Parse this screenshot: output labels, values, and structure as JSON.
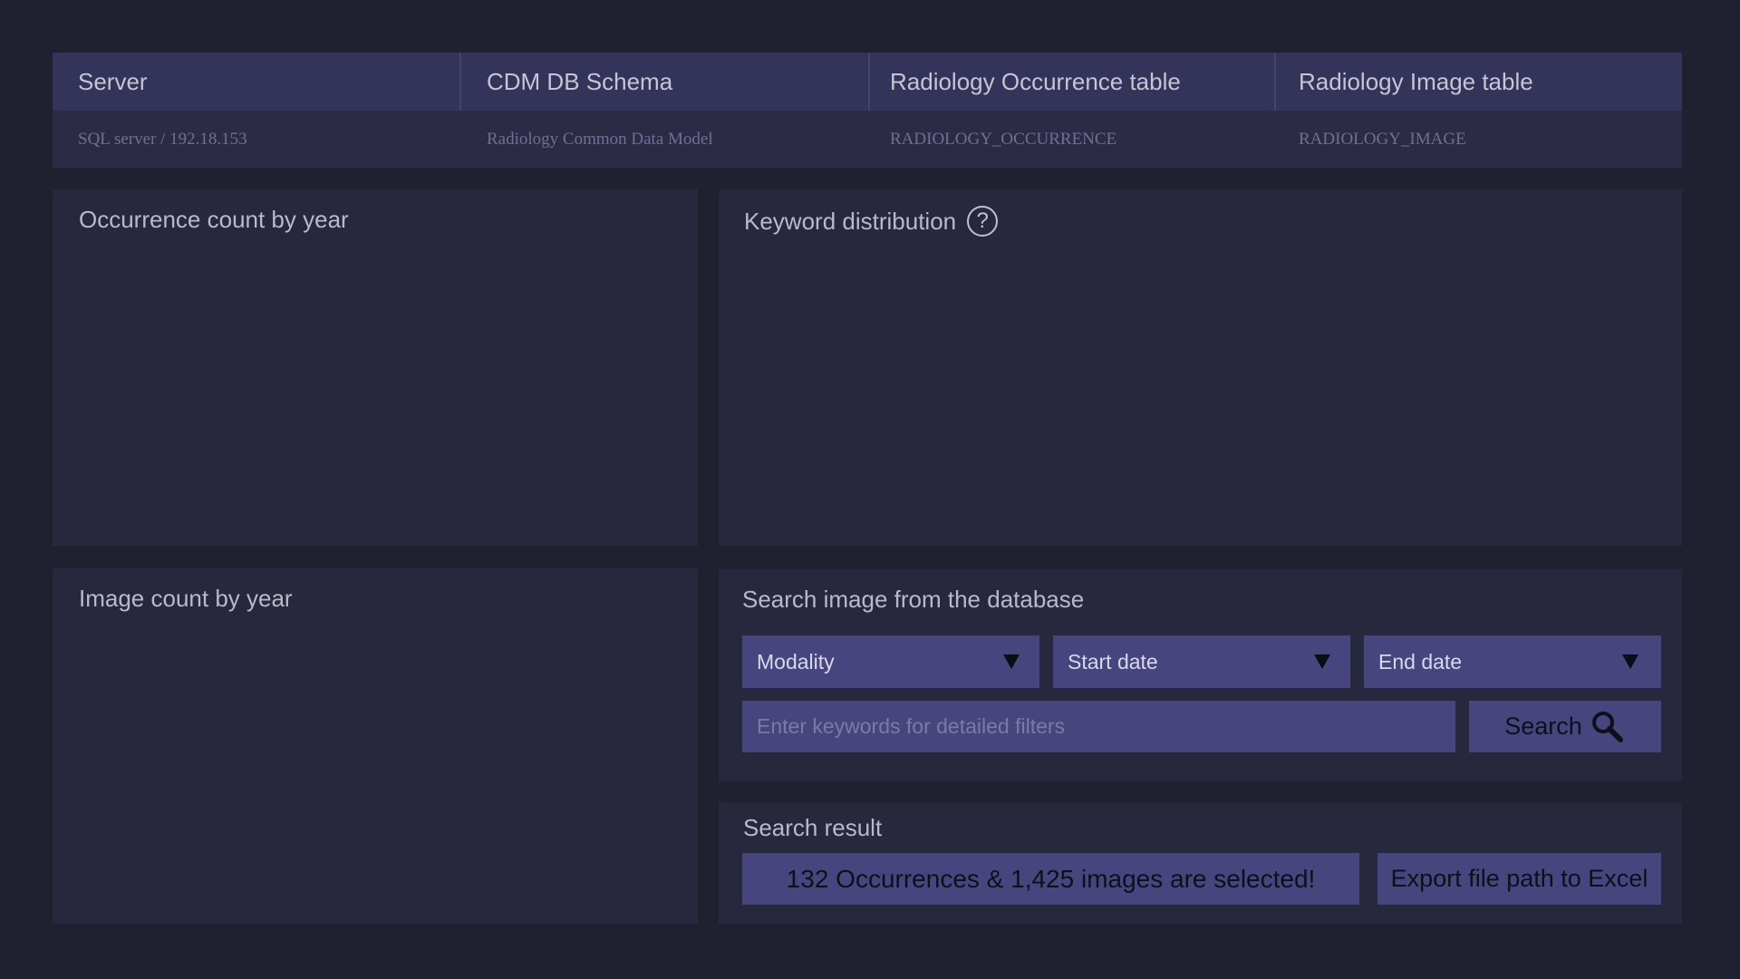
{
  "info_table": {
    "headers": [
      "Server",
      "CDM DB Schema",
      "Radiology Occurrence table",
      "Radiology Image table"
    ],
    "values": [
      "SQL server / 192.18.153",
      "Radiology Common Data Model",
      "RADIOLOGY_OCCURRENCE",
      "RADIOLOGY_IMAGE"
    ]
  },
  "panels": {
    "occurrence_count_title": "Occurrence count by year",
    "keyword_distribution_title": "Keyword distribution",
    "image_count_title": "Image count by year",
    "search_title": "Search image from the database",
    "result_title": "Search result"
  },
  "search": {
    "modality_label": "Modality",
    "start_date_label": "Start date",
    "end_date_label": "End date",
    "keyword_placeholder": "Enter keywords for detailed filters",
    "search_button_label": "Search"
  },
  "result": {
    "summary": "132 Occurrences & 1,425 images are selected!",
    "export_button_label": "Export file path to Excel"
  },
  "icons": {
    "help": "help-circle-icon",
    "dropdown": "triangle-down-icon",
    "search": "magnifier-icon"
  },
  "colors": {
    "background": "#1f2030",
    "panel": "#27273e",
    "control": "#47457e"
  }
}
